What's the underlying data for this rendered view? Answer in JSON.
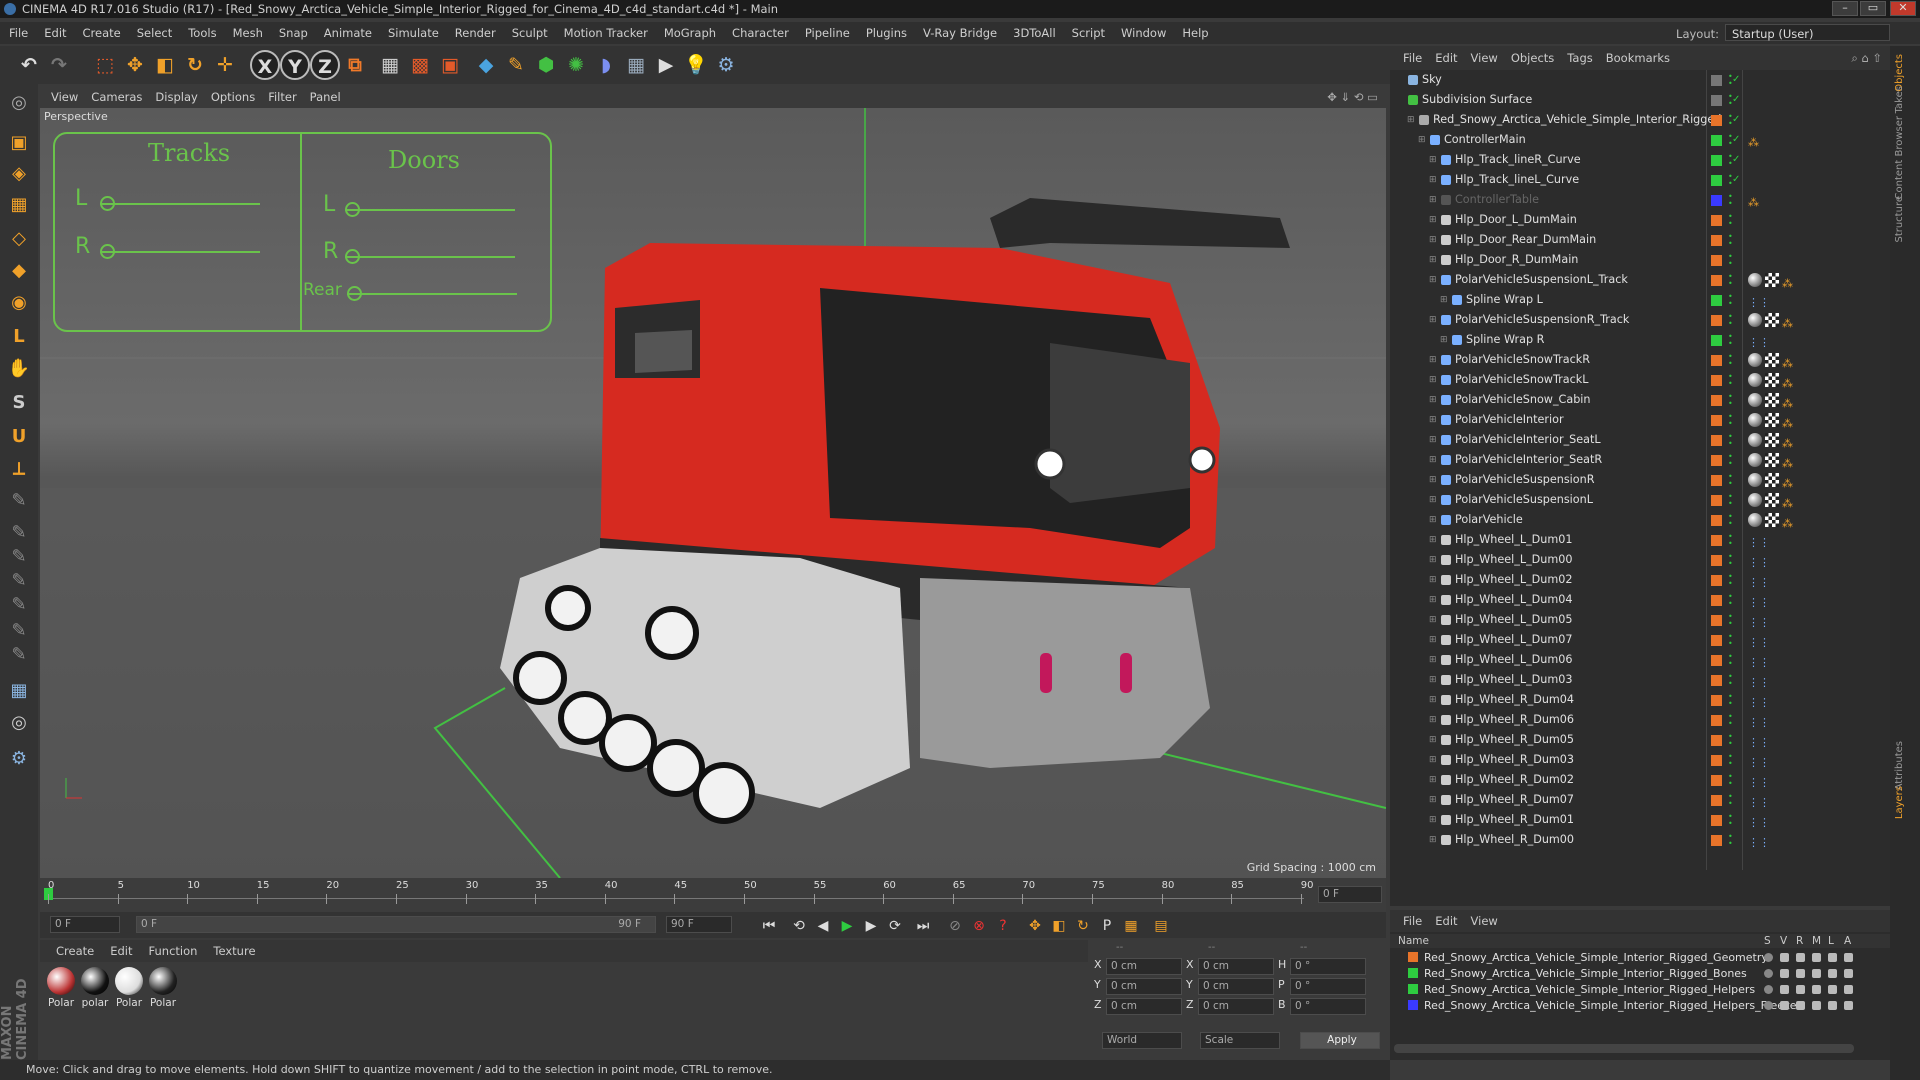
{
  "app": {
    "title": "CINEMA 4D R17.016 Studio (R17) - [Red_Snowy_Arctica_Vehicle_Simple_Interior_Rigged_for_Cinema_4D_c4d_standart.c4d *] - Main",
    "layout_label": "Layout:",
    "layout_value": "Startup (User)"
  },
  "menu": [
    "File",
    "Edit",
    "Create",
    "Select",
    "Tools",
    "Mesh",
    "Snap",
    "Animate",
    "Simulate",
    "Render",
    "Sculpt",
    "Motion Tracker",
    "MoGraph",
    "Character",
    "Pipeline",
    "Plugins",
    "V-Ray Bridge",
    "3DToAll",
    "Script",
    "Window",
    "Help"
  ],
  "toolbar": [
    {
      "name": "undo-icon",
      "glyph": "↶",
      "color": "#dddddd"
    },
    {
      "name": "redo-icon",
      "glyph": "↷",
      "color": "#777777"
    },
    {
      "name": "live-selection-icon",
      "glyph": "⬚",
      "color": "#e35a2a"
    },
    {
      "name": "move-icon",
      "glyph": "✥",
      "color": "#f0a12a"
    },
    {
      "name": "scale-icon",
      "glyph": "◧",
      "color": "#f0a12a"
    },
    {
      "name": "rotate-icon",
      "glyph": "↻",
      "color": "#f0a12a"
    },
    {
      "name": "add-move-icon",
      "glyph": "✛",
      "color": "#f0a12a"
    },
    {
      "name": "x-axis-icon",
      "glyph": "X",
      "color": "#dddddd"
    },
    {
      "name": "y-axis-icon",
      "glyph": "Y",
      "color": "#dddddd"
    },
    {
      "name": "z-axis-icon",
      "glyph": "Z",
      "color": "#dddddd"
    },
    {
      "name": "world-coord-icon",
      "glyph": "⧉",
      "color": "#f07a2a"
    },
    {
      "name": "render-region-icon",
      "glyph": "▦",
      "color": "#cccccc"
    },
    {
      "name": "render-view-icon",
      "glyph": "▩",
      "color": "#e35a2a"
    },
    {
      "name": "render-settings-icon",
      "glyph": "▣",
      "color": "#e35a2a"
    },
    {
      "name": "cube-icon",
      "glyph": "◆",
      "color": "#4aa3df"
    },
    {
      "name": "pen-icon",
      "glyph": "✎",
      "color": "#f0a12a"
    },
    {
      "name": "subdivision-icon",
      "glyph": "⬢",
      "color": "#43c043"
    },
    {
      "name": "array-icon",
      "glyph": "✺",
      "color": "#43c043"
    },
    {
      "name": "deformer-icon",
      "glyph": "◗",
      "color": "#7b8ff0"
    },
    {
      "name": "floor-icon",
      "glyph": "▦",
      "color": "#9ab"
    },
    {
      "name": "camera-icon",
      "glyph": "▶",
      "color": "#dddddd"
    },
    {
      "name": "light-icon",
      "glyph": "💡",
      "color": "#dddddd"
    },
    {
      "name": "python-icon",
      "glyph": "⚙",
      "color": "#8ab4e0"
    }
  ],
  "left_tools": [
    "make-editable-icon",
    "model-mode-icon",
    "texture-mode-icon",
    "workplane-icon",
    "points-mode-icon",
    "edges-mode-icon",
    "polygons-mode-icon",
    "axis-icon",
    "tweak-icon",
    "snap-icon",
    "magnet-icon",
    "quantize-icon",
    "brush-icon",
    "brush-icon-2",
    "brush-icon-3",
    "brush-icon-4",
    "brush-icon-5",
    "brush-icon-6",
    "brush-icon-7",
    "texture-icon",
    "spin-icon",
    "python-icon"
  ],
  "viewport": {
    "menu": [
      "View",
      "Cameras",
      "Display",
      "Options",
      "Filter",
      "Panel"
    ],
    "label": "Perspective",
    "grid_spacing": "Grid Spacing : 1000 cm",
    "hud": {
      "tracks_title": "Tracks",
      "doors_title": "Doors",
      "tracks": [
        {
          "label": "L",
          "value": 0
        },
        {
          "label": "R",
          "value": 0
        }
      ],
      "doors": [
        {
          "label": "L",
          "value": 0
        },
        {
          "label": "R",
          "value": 0
        },
        {
          "label": "Rear",
          "value": 0
        }
      ]
    }
  },
  "timeline": {
    "ticks": [
      "0",
      "5",
      "10",
      "15",
      "20",
      "25",
      "30",
      "35",
      "40",
      "45",
      "50",
      "55",
      "60",
      "65",
      "70",
      "75",
      "80",
      "85",
      "90"
    ],
    "frame_right": "0 F"
  },
  "controls": {
    "start": "0 F",
    "range_left": "0 F",
    "range_right": "90 F",
    "end": "90 F"
  },
  "material": {
    "menu": [
      "Create",
      "Edit",
      "Function",
      "Texture"
    ],
    "items": [
      {
        "label": "Polar",
        "color": "#b33"
      },
      {
        "label": "polar",
        "color": "#111"
      },
      {
        "label": "Polar",
        "color": "#ddd"
      },
      {
        "label": "Polar",
        "color": "#222"
      }
    ]
  },
  "coords": {
    "headers": [
      "--",
      "--",
      "--"
    ],
    "rows": [
      {
        "a": "X",
        "v1": "0 cm",
        "b": "X",
        "v2": "0 cm",
        "c": "H",
        "v3": "0 °"
      },
      {
        "a": "Y",
        "v1": "0 cm",
        "b": "Y",
        "v2": "0 cm",
        "c": "P",
        "v3": "0 °"
      },
      {
        "a": "Z",
        "v1": "0 cm",
        "b": "Z",
        "v2": "0 cm",
        "c": "B",
        "v3": "0 °"
      }
    ],
    "mode1": "World",
    "mode2": "Scale",
    "apply": "Apply"
  },
  "status": "Move: Click and drag to move elements. Hold down SHIFT to quantize movement / add to the selection in point mode, CTRL to remove.",
  "objects": {
    "menu": [
      "File",
      "Edit",
      "View",
      "Objects",
      "Tags",
      "Bookmarks"
    ],
    "rows": [
      {
        "name": "Sky",
        "indent": 0,
        "icon": "#8ab4e0",
        "swatch": "#777",
        "tags": "0"
      },
      {
        "name": "Subdivision Surface",
        "indent": 0,
        "icon": "#43c043",
        "swatch": "#777",
        "tags": "0"
      },
      {
        "name": "Red_Snowy_Arctica_Vehicle_Simple_Interior_Rigged",
        "indent": 1,
        "icon": "#aaa",
        "swatch": "#e8742a",
        "tags": "0"
      },
      {
        "name": "ControllerMain",
        "indent": 2,
        "icon": "#7ab0ff",
        "swatch": "#2ecc40",
        "tags": "1"
      },
      {
        "name": "Hlp_Track_lineR_Curve",
        "indent": 3,
        "icon": "#7ab0ff",
        "swatch": "#2ecc40",
        "tags": "0"
      },
      {
        "name": "Hlp_Track_lineL_Curve",
        "indent": 3,
        "icon": "#7ab0ff",
        "swatch": "#2ecc40",
        "tags": "0"
      },
      {
        "name": "ControllerTable",
        "indent": 3,
        "icon": "#555",
        "swatch": "#3a3aff",
        "tags": "1",
        "dim": true
      },
      {
        "name": "Hlp_Door_L_DumMain",
        "indent": 3,
        "icon": "#ccc",
        "swatch": "#e8742a",
        "tags": "0"
      },
      {
        "name": "Hlp_Door_Rear_DumMain",
        "indent": 3,
        "icon": "#ccc",
        "swatch": "#e8742a",
        "tags": "0"
      },
      {
        "name": "Hlp_Door_R_DumMain",
        "indent": 3,
        "icon": "#ccc",
        "swatch": "#e8742a",
        "tags": "0"
      },
      {
        "name": "PolarVehicleSuspensionL_Track",
        "indent": 3,
        "icon": "#7ab0ff",
        "swatch": "#e8742a",
        "tags": "3"
      },
      {
        "name": "Spline Wrap L",
        "indent": 4,
        "icon": "#7ab0ff",
        "swatch": "#2ecc40",
        "tags": "2"
      },
      {
        "name": "PolarVehicleSuspensionR_Track",
        "indent": 3,
        "icon": "#7ab0ff",
        "swatch": "#e8742a",
        "tags": "3"
      },
      {
        "name": "Spline Wrap R",
        "indent": 4,
        "icon": "#7ab0ff",
        "swatch": "#2ecc40",
        "tags": "2"
      },
      {
        "name": "PolarVehicleSnowTrackR",
        "indent": 3,
        "icon": "#7ab0ff",
        "swatch": "#e8742a",
        "tags": "3"
      },
      {
        "name": "PolarVehicleSnowTrackL",
        "indent": 3,
        "icon": "#7ab0ff",
        "swatch": "#e8742a",
        "tags": "3"
      },
      {
        "name": "PolarVehicleSnow_Cabin",
        "indent": 3,
        "icon": "#7ab0ff",
        "swatch": "#e8742a",
        "tags": "3"
      },
      {
        "name": "PolarVehicleInterior",
        "indent": 3,
        "icon": "#7ab0ff",
        "swatch": "#e8742a",
        "tags": "3"
      },
      {
        "name": "PolarVehicleInterior_SeatL",
        "indent": 3,
        "icon": "#7ab0ff",
        "swatch": "#e8742a",
        "tags": "3"
      },
      {
        "name": "PolarVehicleInterior_SeatR",
        "indent": 3,
        "icon": "#7ab0ff",
        "swatch": "#e8742a",
        "tags": "3"
      },
      {
        "name": "PolarVehicleSuspensionR",
        "indent": 3,
        "icon": "#7ab0ff",
        "swatch": "#e8742a",
        "tags": "3"
      },
      {
        "name": "PolarVehicleSuspensionL",
        "indent": 3,
        "icon": "#7ab0ff",
        "swatch": "#e8742a",
        "tags": "3"
      },
      {
        "name": "PolarVehicle",
        "indent": 3,
        "icon": "#7ab0ff",
        "swatch": "#e8742a",
        "tags": "3"
      },
      {
        "name": "Hlp_Wheel_L_Dum01",
        "indent": 3,
        "icon": "#ccc",
        "swatch": "#e8742a",
        "tags": "2"
      },
      {
        "name": "Hlp_Wheel_L_Dum00",
        "indent": 3,
        "icon": "#ccc",
        "swatch": "#e8742a",
        "tags": "2"
      },
      {
        "name": "Hlp_Wheel_L_Dum02",
        "indent": 3,
        "icon": "#ccc",
        "swatch": "#e8742a",
        "tags": "2"
      },
      {
        "name": "Hlp_Wheel_L_Dum04",
        "indent": 3,
        "icon": "#ccc",
        "swatch": "#e8742a",
        "tags": "2"
      },
      {
        "name": "Hlp_Wheel_L_Dum05",
        "indent": 3,
        "icon": "#ccc",
        "swatch": "#e8742a",
        "tags": "2"
      },
      {
        "name": "Hlp_Wheel_L_Dum07",
        "indent": 3,
        "icon": "#ccc",
        "swatch": "#e8742a",
        "tags": "2"
      },
      {
        "name": "Hlp_Wheel_L_Dum06",
        "indent": 3,
        "icon": "#ccc",
        "swatch": "#e8742a",
        "tags": "2"
      },
      {
        "name": "Hlp_Wheel_L_Dum03",
        "indent": 3,
        "icon": "#ccc",
        "swatch": "#e8742a",
        "tags": "2"
      },
      {
        "name": "Hlp_Wheel_R_Dum04",
        "indent": 3,
        "icon": "#ccc",
        "swatch": "#e8742a",
        "tags": "2"
      },
      {
        "name": "Hlp_Wheel_R_Dum06",
        "indent": 3,
        "icon": "#ccc",
        "swatch": "#e8742a",
        "tags": "2"
      },
      {
        "name": "Hlp_Wheel_R_Dum05",
        "indent": 3,
        "icon": "#ccc",
        "swatch": "#e8742a",
        "tags": "2"
      },
      {
        "name": "Hlp_Wheel_R_Dum03",
        "indent": 3,
        "icon": "#ccc",
        "swatch": "#e8742a",
        "tags": "2"
      },
      {
        "name": "Hlp_Wheel_R_Dum02",
        "indent": 3,
        "icon": "#ccc",
        "swatch": "#e8742a",
        "tags": "2"
      },
      {
        "name": "Hlp_Wheel_R_Dum07",
        "indent": 3,
        "icon": "#ccc",
        "swatch": "#e8742a",
        "tags": "2"
      },
      {
        "name": "Hlp_Wheel_R_Dum01",
        "indent": 3,
        "icon": "#ccc",
        "swatch": "#e8742a",
        "tags": "2"
      },
      {
        "name": "Hlp_Wheel_R_Dum00",
        "indent": 3,
        "icon": "#ccc",
        "swatch": "#e8742a",
        "tags": "2"
      }
    ]
  },
  "layers": {
    "menu": [
      "File",
      "Edit",
      "View"
    ],
    "header_name": "Name",
    "header_cols": [
      "S",
      "V",
      "R",
      "M",
      "L",
      "A"
    ],
    "rows": [
      {
        "name": "Red_Snowy_Arctica_Vehicle_Simple_Interior_Rigged_Geometry",
        "color": "#e8742a"
      },
      {
        "name": "Red_Snowy_Arctica_Vehicle_Simple_Interior_Rigged_Bones",
        "color": "#2ecc40"
      },
      {
        "name": "Red_Snowy_Arctica_Vehicle_Simple_Interior_Rigged_Helpers",
        "color": "#2ecc40"
      },
      {
        "name": "Red_Snowy_Arctica_Vehicle_Simple_Interior_Rigged_Helpers_Freeze",
        "color": "#3a3aff"
      }
    ]
  },
  "side_tabs": [
    "Objects",
    "Takes",
    "Content Browser",
    "Structure",
    "Attributes",
    "Layers"
  ]
}
